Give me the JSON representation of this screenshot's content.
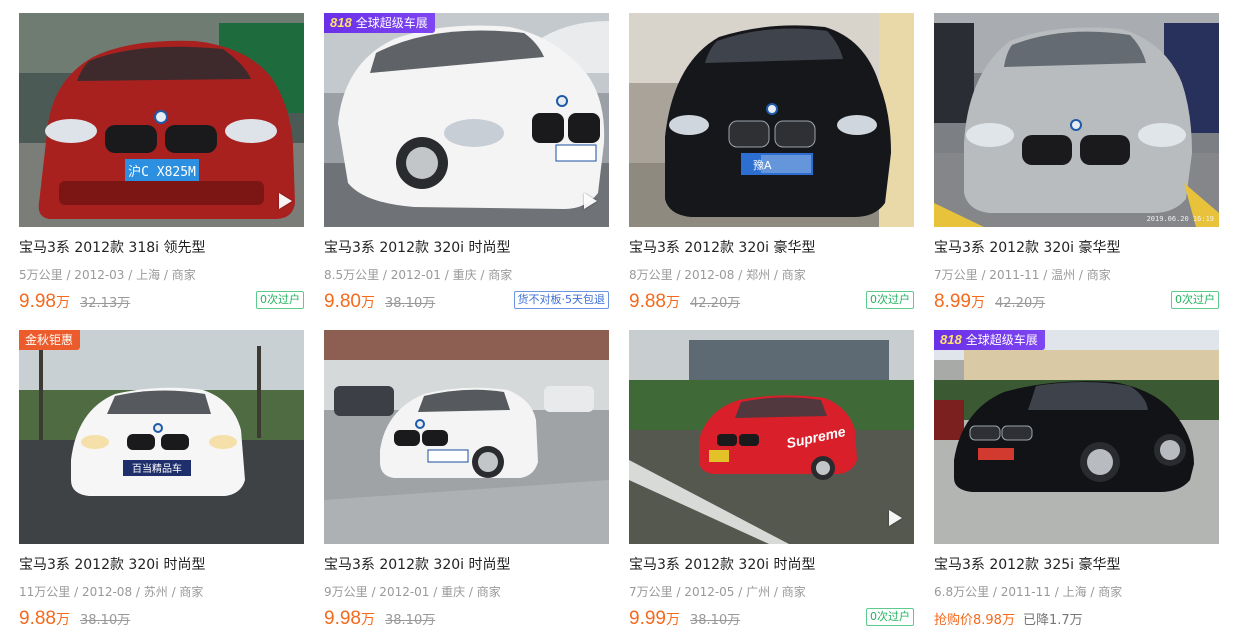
{
  "cars": [
    {
      "title": "宝马3系 2012款 318i 领先型",
      "meta": "5万公里 / 2012-03 / 上海 / 商家",
      "price": "9.98",
      "unit": "万",
      "old_price": "32.13万",
      "tag": "0次过户",
      "tag_color": "green",
      "badge": "",
      "has_video": true,
      "car_color": "#a8211f",
      "plate": "沪C X825M"
    },
    {
      "title": "宝马3系 2012款 320i 时尚型",
      "meta": "8.5万公里 / 2012-01 / 重庆 / 商家",
      "price": "9.80",
      "unit": "万",
      "old_price": "38.10万",
      "tag": "货不对板·5天包退",
      "tag_color": "blue",
      "badge": "全球超级车展",
      "badge_logo": "818",
      "badge_type": "expo",
      "has_video": true,
      "car_color": "#f4f4f4",
      "plate": ""
    },
    {
      "title": "宝马3系 2012款 320i 豪华型",
      "meta": "8万公里 / 2012-08 / 郑州 / 商家",
      "price": "9.88",
      "unit": "万",
      "old_price": "42.20万",
      "tag": "0次过户",
      "tag_color": "green",
      "badge": "",
      "has_video": false,
      "car_color": "#15171b",
      "plate": "豫A"
    },
    {
      "title": "宝马3系 2012款 320i 豪华型",
      "meta": "7万公里 / 2011-11 / 温州 / 商家",
      "price": "8.99",
      "unit": "万",
      "old_price": "42.20万",
      "tag": "0次过户",
      "tag_color": "green",
      "badge": "",
      "has_video": false,
      "car_color": "#b9bcbf",
      "plate": "",
      "timestamp": "2019.06.20 16:19"
    },
    {
      "title": "宝马3系 2012款 320i 时尚型",
      "meta": "11万公里 / 2012-08 / 苏州 / 商家",
      "price": "9.88",
      "unit": "万",
      "old_price": "38.10万",
      "tag": "",
      "tag_color": "",
      "badge": "金秋钜惠",
      "badge_type": "autumn",
      "has_video": false,
      "car_color": "#f6f6f6",
      "plate": "百当精品车"
    },
    {
      "title": "宝马3系 2012款 320i 时尚型",
      "meta": "9万公里 / 2012-01 / 重庆 / 商家",
      "price": "9.98",
      "unit": "万",
      "old_price": "38.10万",
      "tag": "",
      "tag_color": "",
      "badge": "",
      "has_video": false,
      "car_color": "#f4f4f4",
      "plate": ""
    },
    {
      "title": "宝马3系 2012款 320i 时尚型",
      "meta": "7万公里 / 2012-05 / 广州 / 商家",
      "price": "9.99",
      "unit": "万",
      "old_price": "38.10万",
      "tag": "0次过户",
      "tag_color": "green",
      "badge": "",
      "has_video": true,
      "car_color": "#d81f2a",
      "plate": "",
      "wrap": "Supreme"
    },
    {
      "title": "宝马3系 2012款 325i 豪华型",
      "meta": "6.8万公里 / 2011-11 / 上海 / 商家",
      "price": "",
      "unit": "",
      "old_price": "",
      "tag": "",
      "tag_color": "",
      "promo_price": "抢购价8.98万",
      "promo_drop": "已降1.7万",
      "badge": "全球超级车展",
      "badge_logo": "818",
      "badge_type": "expo",
      "has_video": false,
      "car_color": "#111316",
      "plate": ""
    }
  ],
  "colors": {
    "price": "#f5691d",
    "tag_green": "#22b35e",
    "tag_blue": "#3d6fd8",
    "expo_badge": "#6a30e8",
    "autumn_badge": "#ec5b2b"
  }
}
